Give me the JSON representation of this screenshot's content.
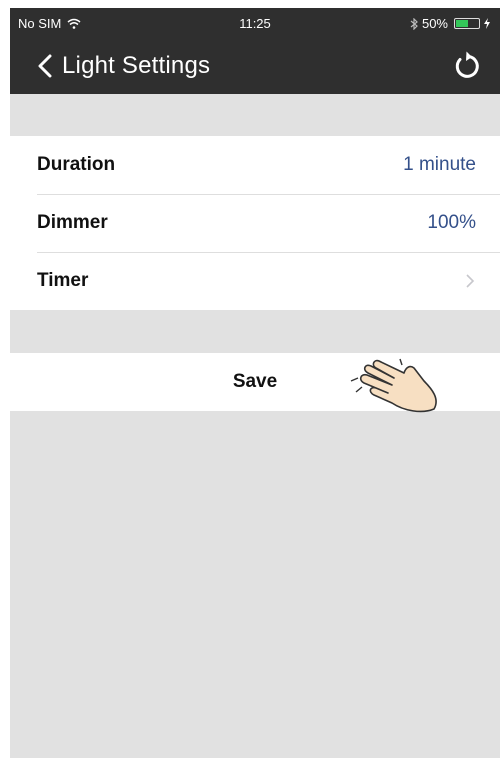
{
  "status_bar": {
    "carrier": "No SIM",
    "time": "11:25",
    "battery": "50%",
    "battery_level": 0.5,
    "icons": [
      "wifi-icon",
      "bluetooth-icon",
      "battery-icon",
      "charging-icon"
    ]
  },
  "nav": {
    "title": "Light Settings",
    "back_icon": "chevron-left-icon",
    "refresh_icon": "refresh-icon"
  },
  "settings": {
    "rows": [
      {
        "label": "Duration",
        "value": "1 minute"
      },
      {
        "label": "Dimmer",
        "value": "100%"
      },
      {
        "label": "Timer",
        "value": ""
      }
    ]
  },
  "save_button": {
    "label": "Save"
  },
  "colors": {
    "nav_bg": "#2f2f2f",
    "value_text": "#34508a",
    "page_bg": "#e1e1e1",
    "battery_fill": "#34c759"
  }
}
